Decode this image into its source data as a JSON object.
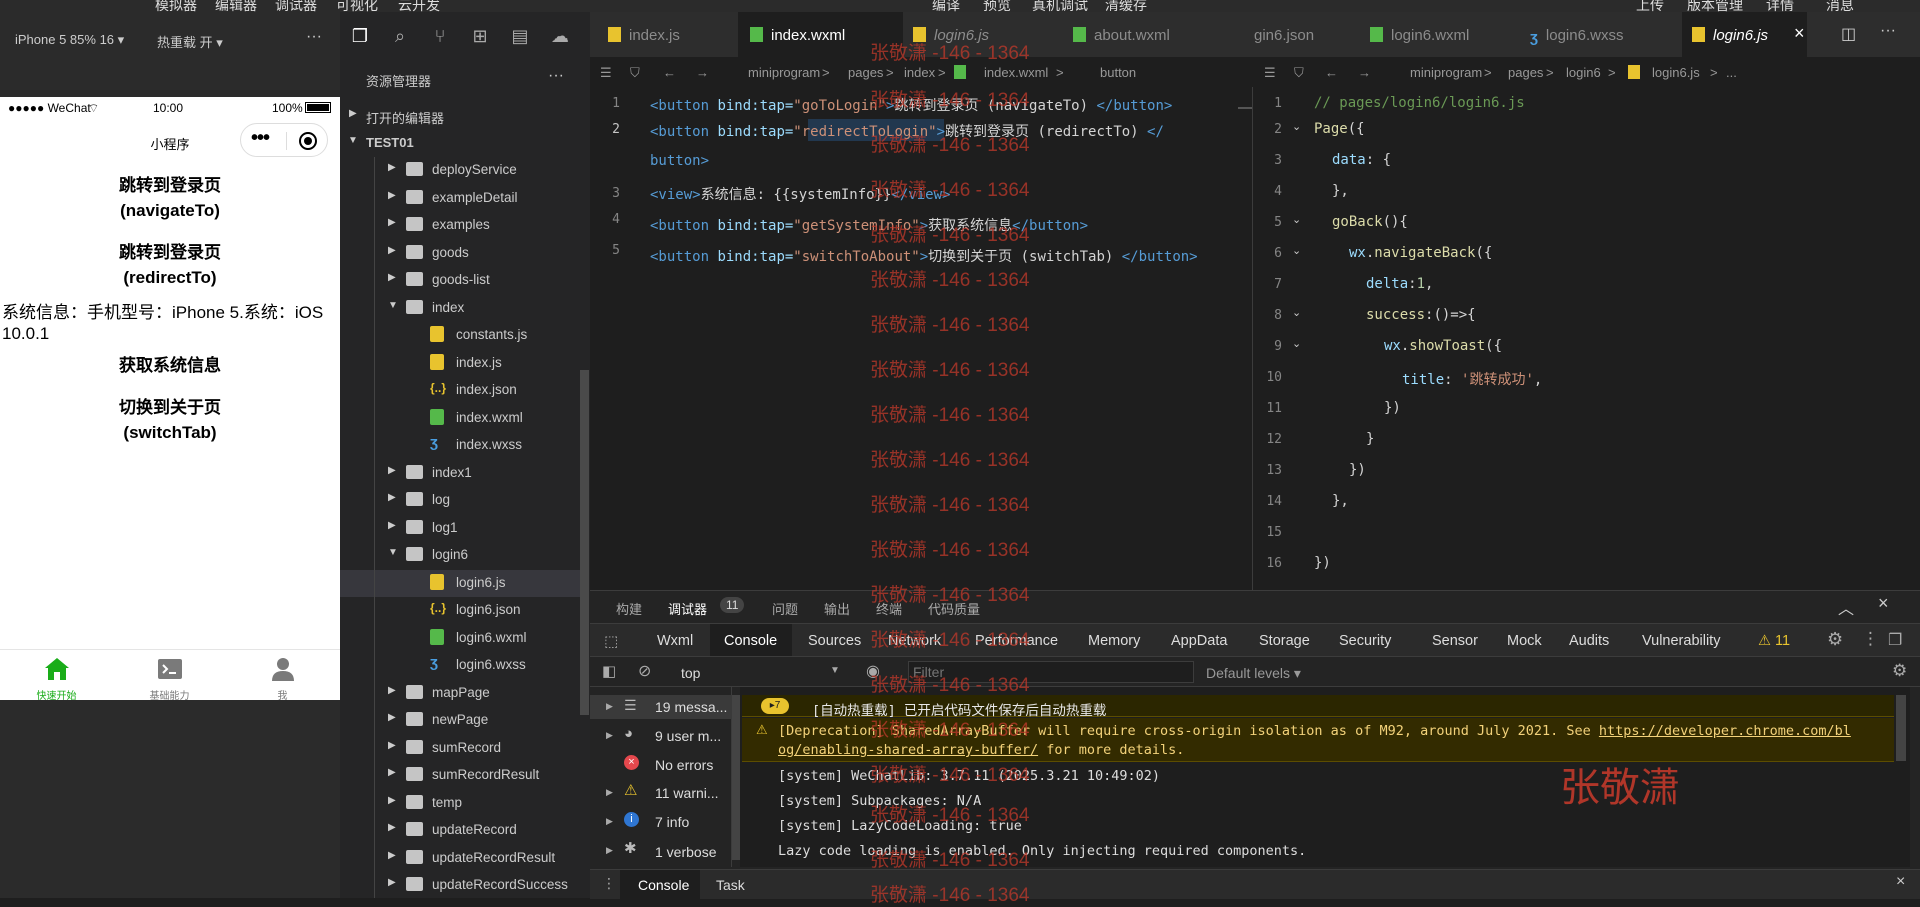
{
  "menu": [
    "模拟器",
    "编辑器",
    "调试器",
    "可视化",
    "云开发",
    "编译",
    "预览",
    "真机调试",
    "清缓存",
    "上传",
    "版本管理",
    "详情",
    "消息"
  ],
  "simulator": {
    "device": "iPhone 5 85% 16 ▾",
    "hot_reload": "热重载 开 ▾",
    "more": "···"
  },
  "phone": {
    "signal": "●●●●● WeChat",
    "time": "10:00",
    "battery": "100%",
    "title": "小程序",
    "btn1_l1": "跳转到登录页",
    "btn1_l2": "(navigateTo)",
    "btn2_l1": "跳转到登录页",
    "btn2_l2": "(redirectTo)",
    "sysinfo": "系统信息：手机型号：iPhone 5.系统：iOS 10.0.1",
    "btn3": "获取系统信息",
    "btn4_l1": "切换到关于页",
    "btn4_l2": "(switchTab)",
    "tabs": [
      {
        "label": "快速开始",
        "icon": "home-icon",
        "color": "#1aad19"
      },
      {
        "label": "基础能力",
        "icon": "terminal-icon",
        "color": "#7a7a7a"
      },
      {
        "label": "我",
        "icon": "user-icon",
        "color": "#7a7a7a"
      }
    ]
  },
  "explorer": {
    "title": "资源管理器",
    "more": "···",
    "open_editors": "打开的编辑器",
    "project": "TEST01",
    "items": [
      {
        "label": "deployService",
        "type": "folder"
      },
      {
        "label": "exampleDetail",
        "type": "folder"
      },
      {
        "label": "examples",
        "type": "folder"
      },
      {
        "label": "goods",
        "type": "folder"
      },
      {
        "label": "goods-list",
        "type": "folder"
      },
      {
        "label": "index",
        "type": "folder-open"
      },
      {
        "label": "constants.js",
        "type": "js"
      },
      {
        "label": "index.js",
        "type": "js"
      },
      {
        "label": "index.json",
        "type": "json"
      },
      {
        "label": "index.wxml",
        "type": "wxml"
      },
      {
        "label": "index.wxss",
        "type": "wxss"
      },
      {
        "label": "index1",
        "type": "folder"
      },
      {
        "label": "log",
        "type": "folder"
      },
      {
        "label": "log1",
        "type": "folder"
      },
      {
        "label": "login6",
        "type": "folder-open"
      },
      {
        "label": "login6.js",
        "type": "js"
      },
      {
        "label": "login6.json",
        "type": "json"
      },
      {
        "label": "login6.wxml",
        "type": "wxml"
      },
      {
        "label": "login6.wxss",
        "type": "wxss"
      },
      {
        "label": "mapPage",
        "type": "folder"
      },
      {
        "label": "newPage",
        "type": "folder"
      },
      {
        "label": "sumRecord",
        "type": "folder"
      },
      {
        "label": "sumRecordResult",
        "type": "folder"
      },
      {
        "label": "temp",
        "type": "folder"
      },
      {
        "label": "updateRecord",
        "type": "folder"
      },
      {
        "label": "updateRecordResult",
        "type": "folder"
      },
      {
        "label": "updateRecordSuccess",
        "type": "folder"
      }
    ]
  },
  "editor_tabs_left": [
    "index.js",
    "index.wxml",
    "login6.js",
    "about.wxml"
  ],
  "editor_tabs_right": [
    "gin6.json",
    "login6.wxml",
    "login6.wxss",
    "login6.js"
  ],
  "crumbs_left": [
    "miniprogram",
    ">",
    "pages",
    ">",
    "index",
    ">",
    "index.wxml",
    ">",
    "button"
  ],
  "crumbs_right": [
    "miniprogram",
    ">",
    "pages",
    ">",
    "login6",
    ">",
    "login6.js",
    ">",
    "..."
  ],
  "code_left": {
    "l1_tag": "<button ",
    "l1_attr": "bind:tap=",
    "l1_str": "\"goToLogin\"",
    "l1_end": ">",
    "l1_text": "跳转到登录页 (navigateTo) ",
    "l1_close": "</button>",
    "l2_tag": "<button ",
    "l2_attr": "bind:tap=",
    "l2_str": "\"redirectToLogin\"",
    "l2_end": ">",
    "l2_text": "跳转到登录页 (redirectTo) ",
    "l2_close_a": "</",
    "l2_close_b": "button>",
    "l3_tag": "<view>",
    "l3_text": "系统信息: {{systemInfo}}",
    "l3_close": "</view>",
    "l4_tag": "<button ",
    "l4_attr": "bind:tap=",
    "l4_str": "\"getSystemInfo\"",
    "l4_end": ">",
    "l4_text": "获取系统信息",
    "l4_close": "</button>",
    "l5_tag": "<button ",
    "l5_attr": "bind:tap=",
    "l5_str": "\"switchToAbout\"",
    "l5_end": ">",
    "l5_text": "切换到关于页 (switchTab) ",
    "l5_close": "</button>"
  },
  "code_right": {
    "l1": "// pages/login6/login6.js",
    "l2a": "Page",
    "l2b": "({",
    "l3a": "data",
    "l3b": ": {",
    "l4": "},",
    "l5a": "goBack",
    "l5b": "(){",
    "l6a": "wx",
    "l6b": ".",
    "l6c": "navigateBack",
    "l6d": "({",
    "l7a": "delta",
    "l7b": ":",
    "l7c": "1",
    "l7d": ",",
    "l8a": "success",
    "l8b": ":()=>{",
    "l9a": "wx",
    "l9b": ".",
    "l9c": "showToast",
    "l9d": "({",
    "l10a": "title",
    "l10b": ": ",
    "l10c": "'跳转成功'",
    "l10d": ",",
    "l11": "})",
    "l12": "}",
    "l13": "})",
    "l14": "},",
    "l16": "})"
  },
  "watermark": "张敬潇 -146 - 1364",
  "watermark_big": "张敬潇",
  "devtools": {
    "top_tabs": [
      "构建",
      "调试器",
      "问题",
      "输出",
      "终端",
      "代码质量"
    ],
    "badge": "11",
    "tabs": [
      "Wxml",
      "Console",
      "Sources",
      "Network",
      "Performance",
      "Memory",
      "AppData",
      "Storage",
      "Security",
      "Sensor",
      "Mock",
      "Audits",
      "Vulnerability"
    ],
    "warn_count": "⚠ 11",
    "context": "top",
    "filter_placeholder": "Filter",
    "levels": "Default levels ▾",
    "sidebar": [
      "19 messa...",
      "9 user m...",
      "No errors",
      "11 warni...",
      "7 info",
      "1 verbose"
    ],
    "messages": [
      "[自动热重载] 已开启代码文件保存后自动热重载",
      "[Deprecation] SharedArrayBuffer will require cross-origin isolation as of M92, around July 2021. See ",
      "https://developer.chrome.com/bl",
      "og/enabling-shared-array-buffer/",
      " for more details.",
      "[system] WeChatLib: 3.7.11 (2025.3.21 10:49:02)",
      "[system] Subpackages: N/A",
      "[system] LazyCodeLoading: true",
      "Lazy code loading is enabled. Only injecting required components."
    ],
    "bottom_tabs": [
      "Console",
      "Task"
    ]
  }
}
